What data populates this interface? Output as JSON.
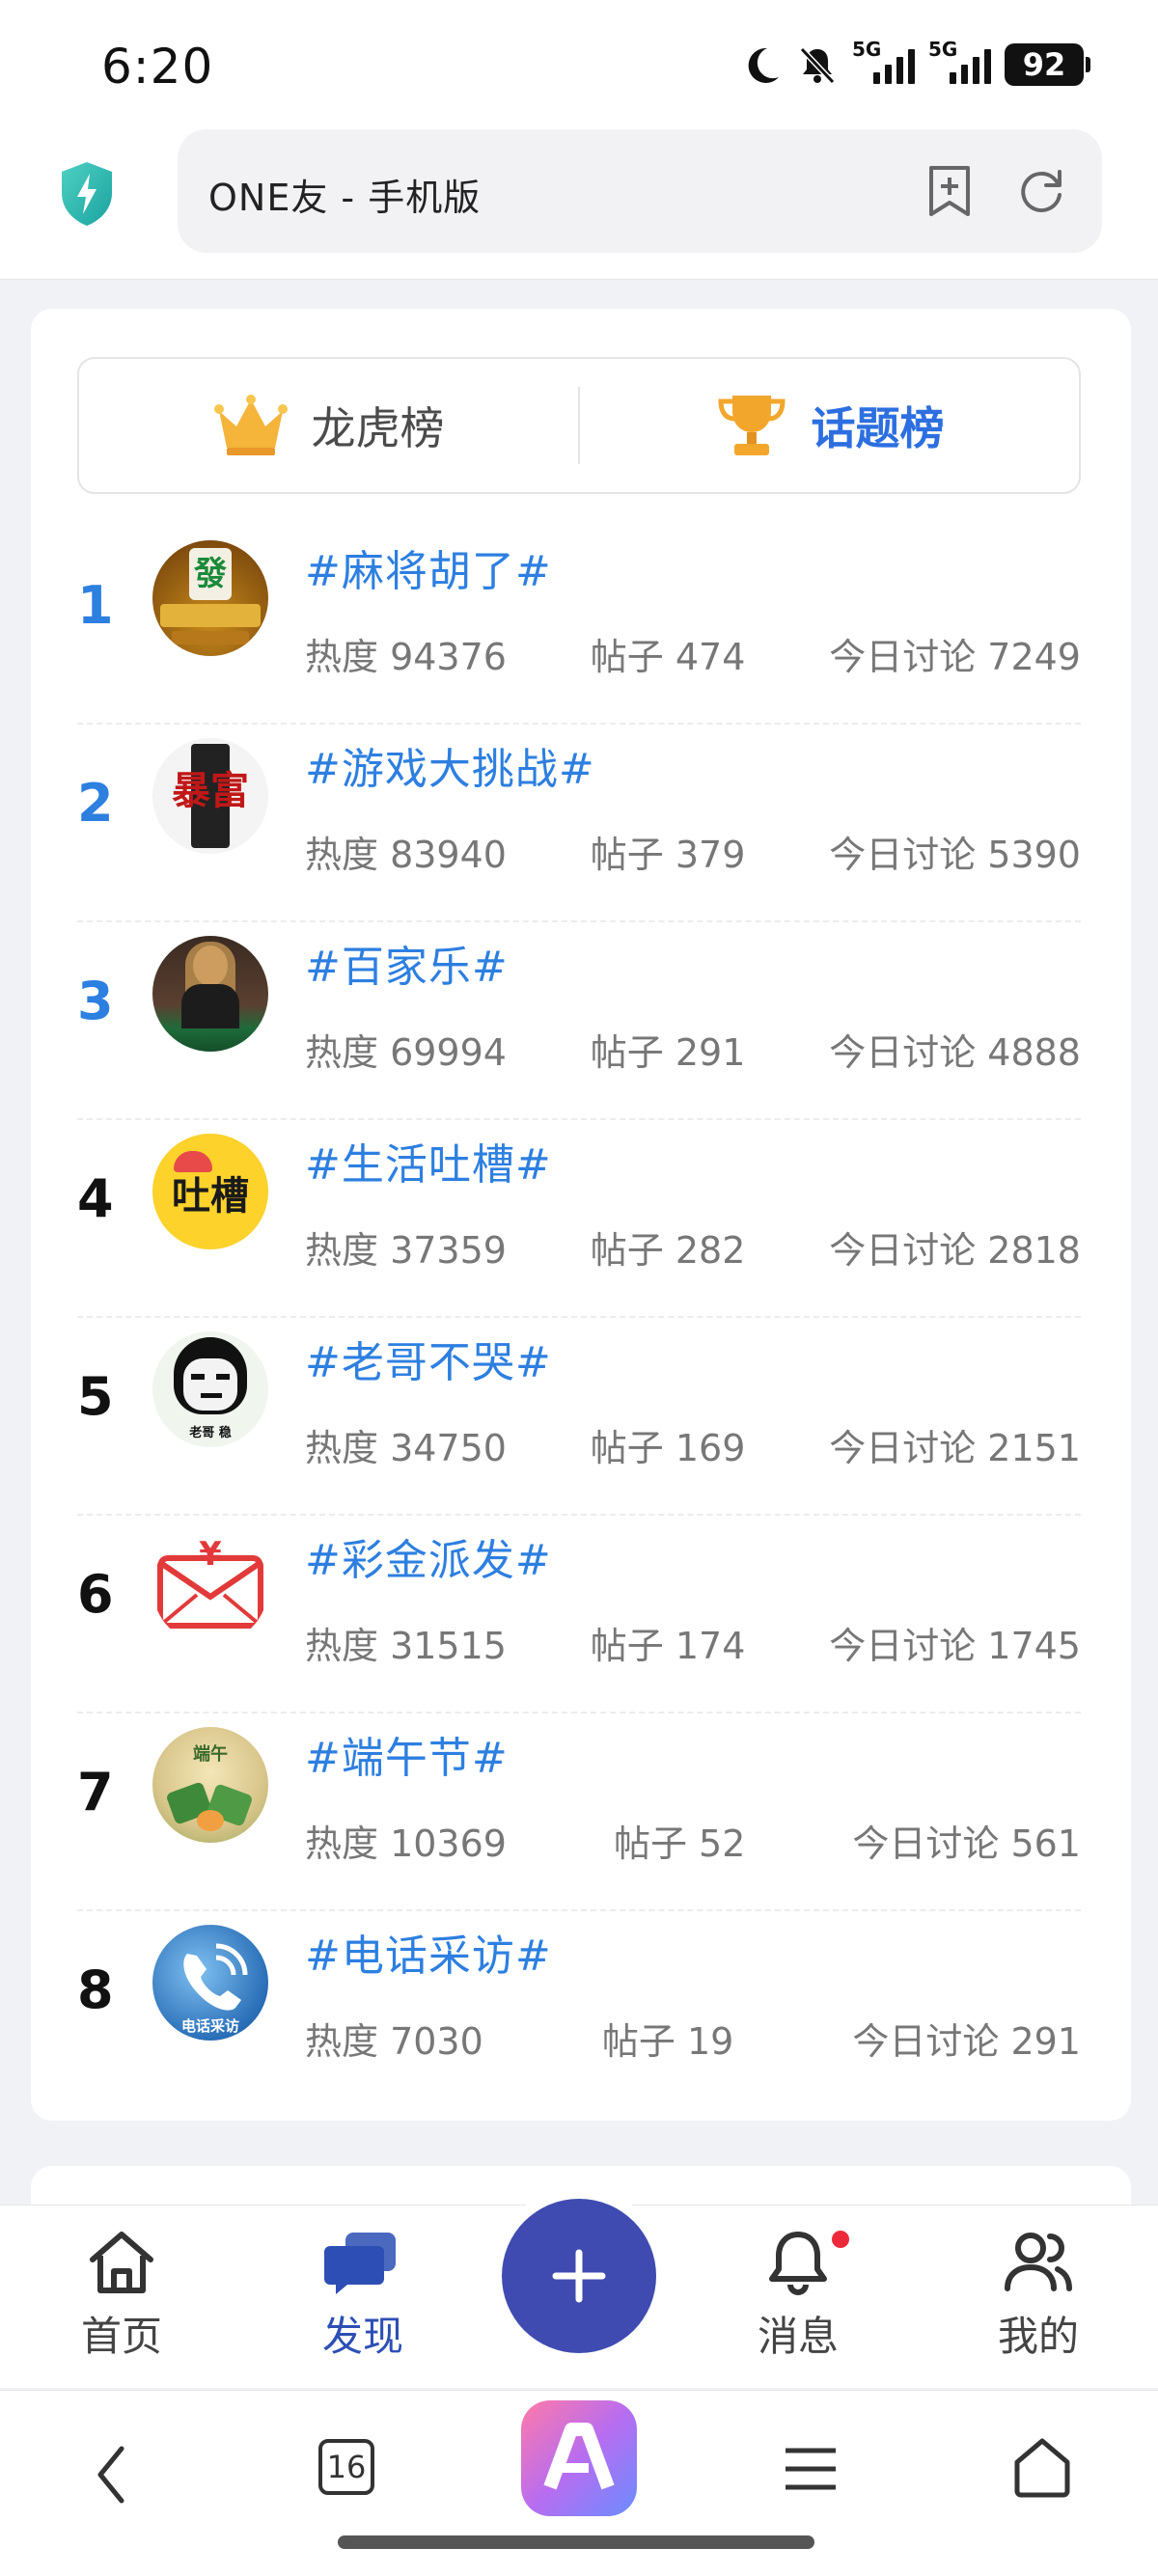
{
  "status": {
    "time": "6:20",
    "signal1_label": "5G",
    "signal2_label": "5G",
    "battery": "92"
  },
  "browser": {
    "url_title": "ONE友 - 手机版"
  },
  "tabs": [
    {
      "label": "龙虎榜",
      "icon": "crown-icon",
      "active": false
    },
    {
      "label": "话题榜",
      "icon": "trophy-icon",
      "active": true
    }
  ],
  "topics": [
    {
      "rank": "1",
      "title": "#麻将胡了#",
      "heat": "热度 94376",
      "posts": "帖子 474",
      "today": "今日讨论 7249",
      "avatar_text": "發"
    },
    {
      "rank": "2",
      "title": "#游戏大挑战#",
      "heat": "热度 83940",
      "posts": "帖子 379",
      "today": "今日讨论 5390",
      "avatar_text": "暴富"
    },
    {
      "rank": "3",
      "title": "#百家乐#",
      "heat": "热度 69994",
      "posts": "帖子 291",
      "today": "今日讨论 4888",
      "avatar_text": ""
    },
    {
      "rank": "4",
      "title": "#生活吐槽#",
      "heat": "热度 37359",
      "posts": "帖子 282",
      "today": "今日讨论 2818",
      "avatar_text": "吐槽"
    },
    {
      "rank": "5",
      "title": "#老哥不哭#",
      "heat": "热度 34750",
      "posts": "帖子 169",
      "today": "今日讨论 2151",
      "avatar_text": "老哥 稳"
    },
    {
      "rank": "6",
      "title": "#彩金派发#",
      "heat": "热度 31515",
      "posts": "帖子 174",
      "today": "今日讨论 1745",
      "avatar_text": "¥"
    },
    {
      "rank": "7",
      "title": "#端午节#",
      "heat": "热度 10369",
      "posts": "帖子 52",
      "today": "今日讨论 561",
      "avatar_text": "端午"
    },
    {
      "rank": "8",
      "title": "#电话采访#",
      "heat": "热度 7030",
      "posts": "帖子 19",
      "today": "今日讨论 291",
      "avatar_text": "电话采访"
    }
  ],
  "tabbar": {
    "home": "首页",
    "discover": "发现",
    "messages": "消息",
    "mine": "我的"
  },
  "navbar": {
    "tabs_count": "16"
  },
  "colors": {
    "accent": "#2d7fe0",
    "add_button": "#3f4bb0",
    "badge": "#ee2a3a"
  }
}
